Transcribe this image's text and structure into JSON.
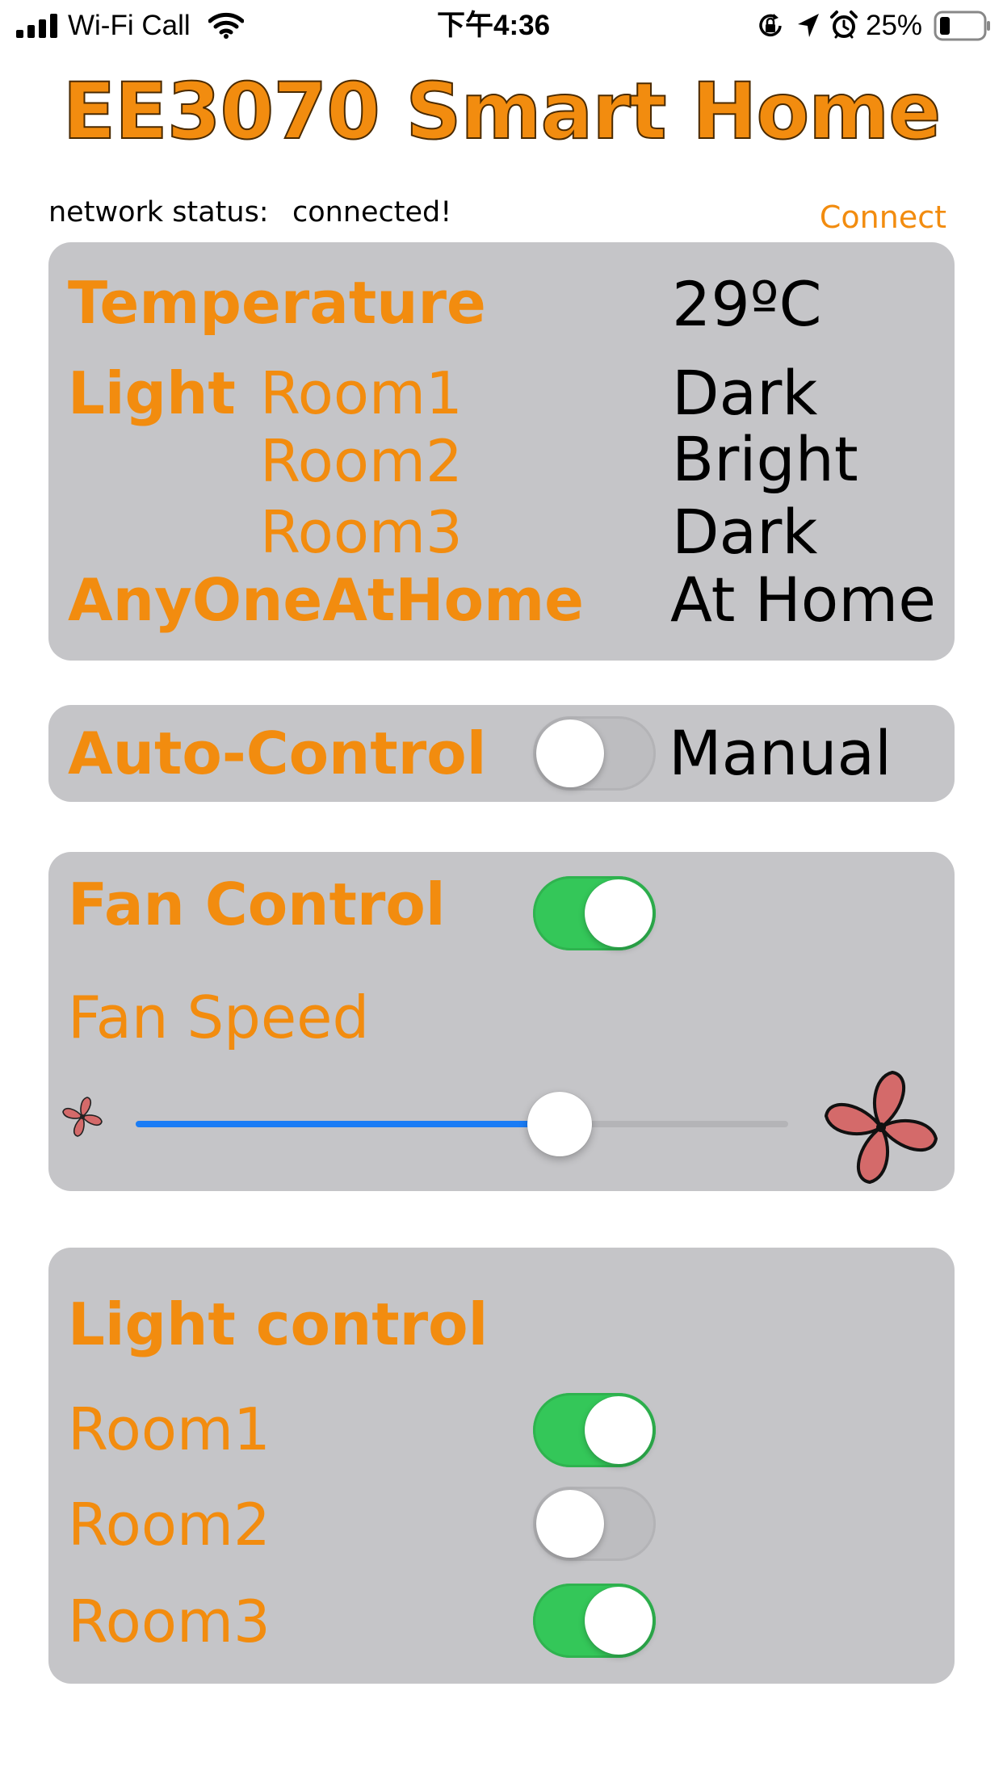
{
  "status_bar": {
    "carrier": "Wi-Fi Call",
    "time": "下午4:36",
    "battery": "25%"
  },
  "title": "EE3070 Smart Home",
  "network": {
    "label": "network status:",
    "value": "connected!",
    "connect_label": "Connect"
  },
  "sensors": {
    "temperature_label": "Temperature",
    "temperature_value": "29ºC",
    "light_label": "Light",
    "rooms": [
      {
        "label": "Room1",
        "value": "Dark"
      },
      {
        "label": "Room2",
        "value": "Bright"
      },
      {
        "label": "Room3",
        "value": "Dark"
      }
    ],
    "presence_label": "AnyOneAtHome",
    "presence_value": "At Home"
  },
  "auto_control": {
    "label": "Auto-Control",
    "switch_on": false,
    "mode_value": "Manual"
  },
  "fan_control": {
    "label": "Fan Control",
    "switch_on": true,
    "speed_label": "Fan Speed",
    "speed_fraction": 0.65
  },
  "light_control": {
    "label": "Light control",
    "rooms": [
      {
        "label": "Room1",
        "on": true
      },
      {
        "label": "Room2",
        "on": false
      },
      {
        "label": "Room3",
        "on": true
      }
    ]
  },
  "colors": {
    "accent": "#f28c0f",
    "card": "#c5c5c8",
    "switch_on": "#34c759",
    "slider_fill": "#1a7cf5"
  },
  "icons": [
    "cellular-signal-icon",
    "wifi-icon",
    "orientation-lock-icon",
    "location-arrow-icon",
    "alarm-icon",
    "battery-icon",
    "fan-small-icon",
    "fan-large-icon"
  ]
}
